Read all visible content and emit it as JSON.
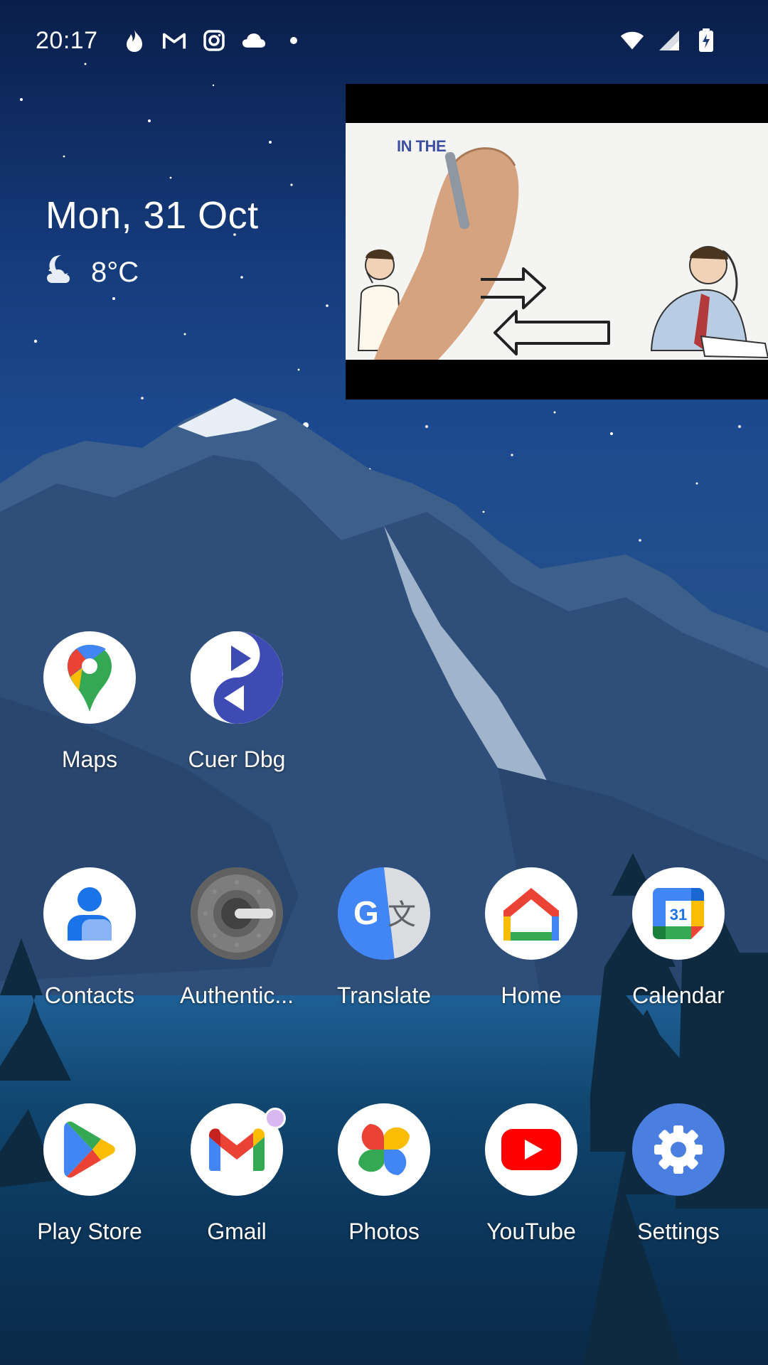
{
  "status_bar": {
    "time": "20:17",
    "left_icons": [
      "flame-icon",
      "gmail-m-icon",
      "instagram-icon",
      "cloud-icon",
      "dot-icon"
    ],
    "right_icons": [
      "wifi-icon",
      "signal-icon",
      "battery-charging-icon"
    ]
  },
  "date_widget": {
    "date": "Mon, 31 Oct",
    "weather_icon": "moon-cloud-icon",
    "temperature": "8°C"
  },
  "pip_video": {
    "caption": "IN THE"
  },
  "apps": {
    "row1": [
      {
        "label": "Maps",
        "icon": "google-maps-icon"
      },
      {
        "label": "Cuer Dbg",
        "icon": "cuer-yin-yang-icon"
      }
    ],
    "row2": [
      {
        "label": "Contacts",
        "icon": "contacts-person-icon"
      },
      {
        "label": "Authentic...",
        "icon": "authenticator-icon"
      },
      {
        "label": "Translate",
        "icon": "translate-icon"
      },
      {
        "label": "Home",
        "icon": "google-home-icon"
      },
      {
        "label": "Calendar",
        "icon": "calendar-icon",
        "badge": "31"
      }
    ],
    "row3": [
      {
        "label": "Play Store",
        "icon": "play-store-icon"
      },
      {
        "label": "Gmail",
        "icon": "gmail-icon",
        "has_notification": true
      },
      {
        "label": "Photos",
        "icon": "photos-pinwheel-icon"
      },
      {
        "label": "YouTube",
        "icon": "youtube-icon"
      },
      {
        "label": "Settings",
        "icon": "settings-gear-icon"
      }
    ]
  }
}
